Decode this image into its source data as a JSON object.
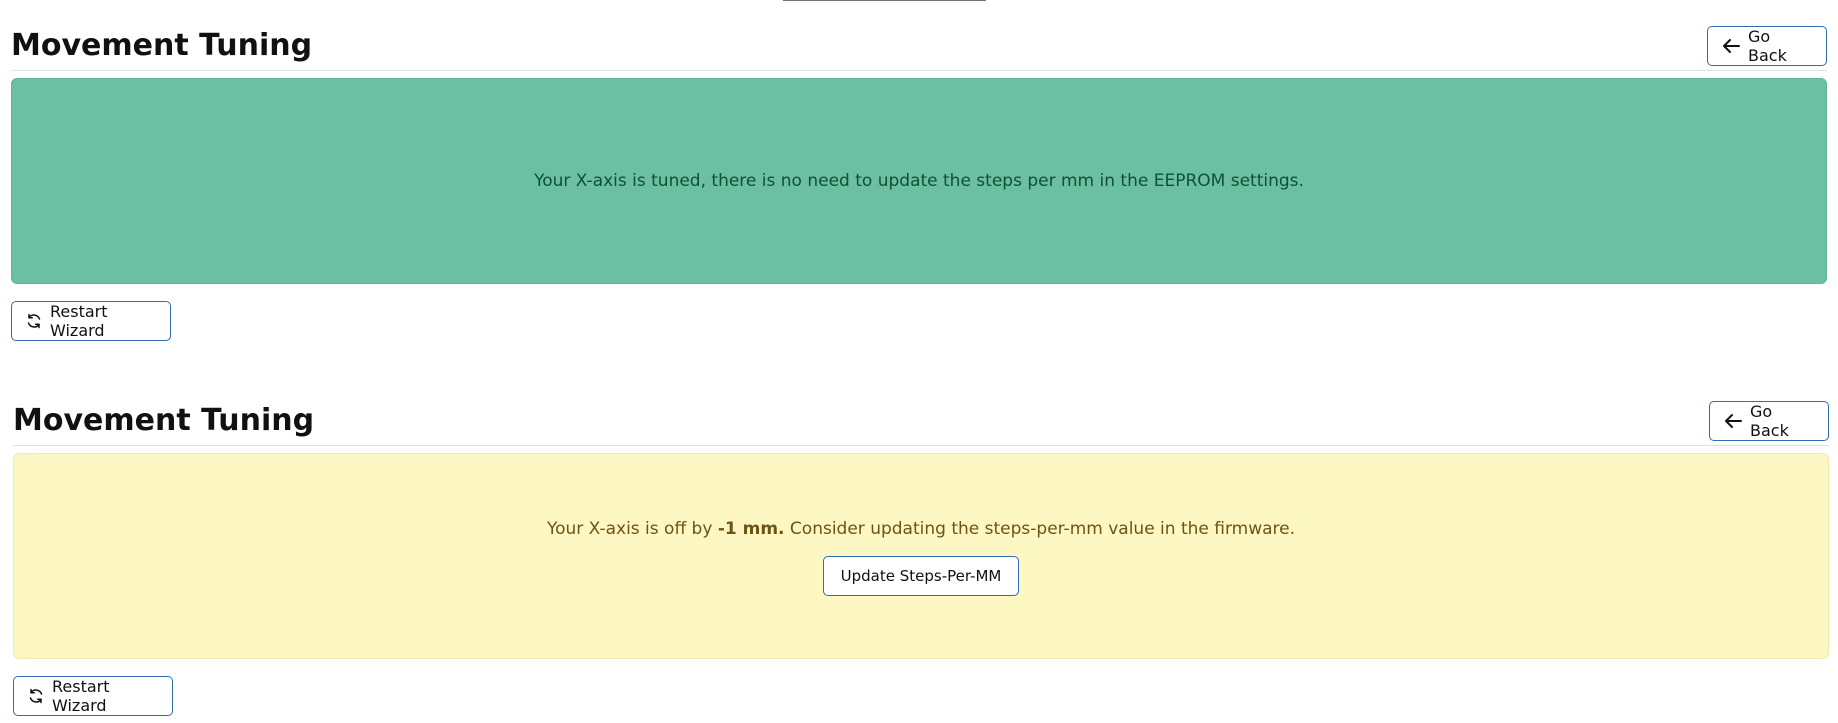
{
  "panels": [
    {
      "title": "Movement Tuning",
      "go_back_label": "Go Back",
      "alert": {
        "kind": "success",
        "text": "Your X-axis is tuned, there is no need to update the steps per mm in the EEPROM settings."
      },
      "restart_label": "Restart Wizard"
    },
    {
      "title": "Movement Tuning",
      "go_back_label": "Go Back",
      "alert": {
        "kind": "warning",
        "text_before": "Your X-axis is off by ",
        "offset_value": "-1 mm.",
        "text_after": " Consider updating the steps-per-mm value in the firmware.",
        "action_label": "Update Steps-Per-MM"
      },
      "restart_label": "Restart Wizard"
    }
  ],
  "colors": {
    "success_bg": "#6bbfa3",
    "success_text": "#0f5132",
    "warning_bg": "#fdf7c3",
    "warning_text": "#6e5412",
    "button_border": "#2f6db0"
  },
  "icons": {
    "go_back": "arrow-left-icon",
    "restart": "refresh-icon"
  }
}
